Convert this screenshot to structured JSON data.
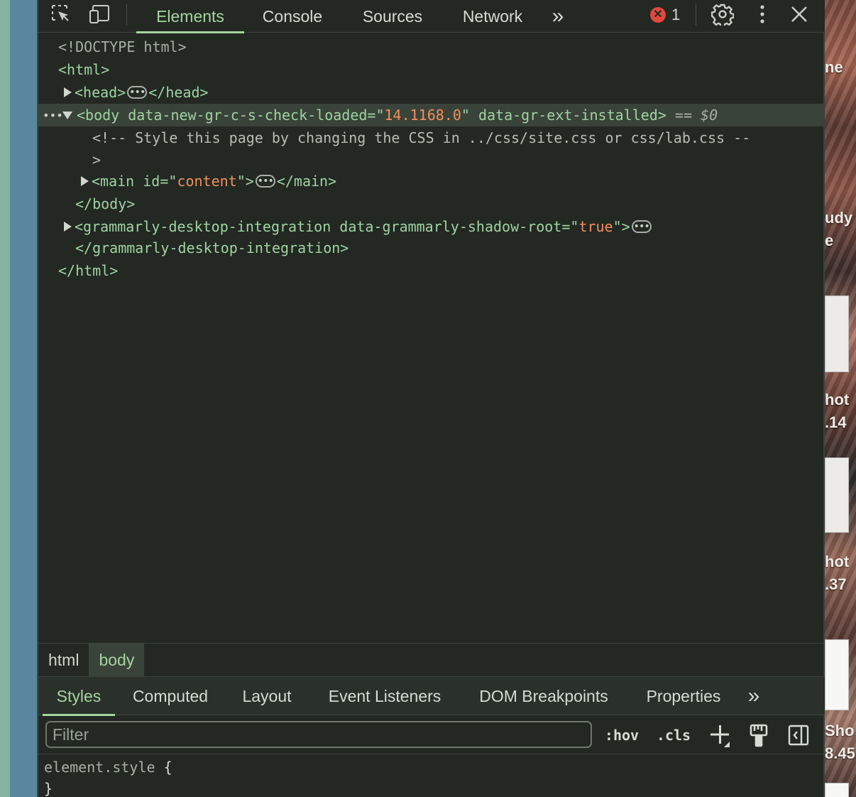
{
  "toolbar": {
    "tabs": [
      {
        "label": "Elements",
        "active": true
      },
      {
        "label": "Console",
        "active": false
      },
      {
        "label": "Sources",
        "active": false
      },
      {
        "label": "Network",
        "active": false
      }
    ],
    "more_tabs_glyph": "»",
    "error_count": "1",
    "icons": [
      "inspect-element-icon",
      "device-toolbar-icon",
      "more-tabs-icon",
      "error-icon",
      "settings-gear-icon",
      "kebab-menu-icon",
      "close-icon"
    ]
  },
  "dom": {
    "doctype": "<!DOCTYPE html>",
    "html_open": "<html>",
    "head_open": "<head>",
    "head_close": "</head>",
    "body_open_tag": "<body",
    "body_attr1_name": " data-new-gr-c-s-check-loaded=\"",
    "body_attr1_value": "14.1168.0",
    "body_attr1_close": "\"",
    "body_attr2": " data-gr-ext-installed>",
    "selected_marker_eq": " == ",
    "selected_marker_var": "$0",
    "comment_line1": "<!-- Style this page by changing the CSS in ../css/site.css or css/lab.css --",
    "comment_line2": ">",
    "main_open": "<main",
    "main_attr_name": " id=\"",
    "main_attr_value": "content",
    "main_attr_close": "\">",
    "main_close": "</main>",
    "body_close": "</body>",
    "grammarly_open": "<grammarly-desktop-integration",
    "grammarly_attr_name": " data-grammarly-shadow-root=\"",
    "grammarly_attr_value": "true",
    "grammarly_attr_close": "\">",
    "grammarly_close": "</grammarly-desktop-integration>",
    "html_close": "</html>",
    "ellipsis": "•••",
    "gutter_dots": "•••"
  },
  "breadcrumbs": [
    {
      "label": "html",
      "active": false
    },
    {
      "label": "body",
      "active": true
    }
  ],
  "panel_tabs": [
    {
      "label": "Styles",
      "active": true
    },
    {
      "label": "Computed",
      "active": false
    },
    {
      "label": "Layout",
      "active": false
    },
    {
      "label": "Event Listeners",
      "active": false
    },
    {
      "label": "DOM Breakpoints",
      "active": false
    },
    {
      "label": "Properties",
      "active": false
    }
  ],
  "panel_more_glyph": "»",
  "filter": {
    "placeholder": "Filter",
    "hov_label": ":hov",
    "cls_label": ".cls"
  },
  "styles": {
    "selector": "element.style",
    "open_brace": " {",
    "close_brace": "}"
  },
  "desktop_right": {
    "labels": [
      "ne",
      "udy",
      "e",
      "hot",
      ".14",
      "hot",
      ".37",
      "Sho",
      "8.45"
    ]
  },
  "colors": {
    "background": "#232823",
    "accent": "#a6d39f",
    "attr_value": "#f08f5d",
    "error": "#e0483f",
    "selected_row": "#3a4339"
  }
}
